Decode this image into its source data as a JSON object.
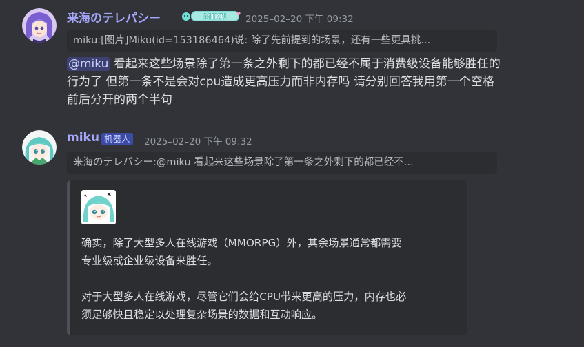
{
  "messages": [
    {
      "username": "来海のテレパシー",
      "username_color": "#a5a8fc",
      "badge_text": "MIKU",
      "timestamp": "2025–02–20 下午 09:32",
      "reply_preview": "miku:[图片]Miku(id=153186464)说: 除了先前提到的场景，还有一些更具挑...",
      "mention": "@miku",
      "content_line1": " 看起来这些场景除了第一条之外剩下的都已经不属于消费级设备能够胜任的",
      "content_line2": "行为了 但第一条不是会对cpu造成更高压力而非内存吗 请分别回答我用第一个空格",
      "content_line3": "前后分开的两个半句"
    },
    {
      "username": "miku",
      "username_color": "#a5a8fc",
      "bot_tag": "机器人",
      "timestamp": "2025–02–20 下午 09:32",
      "reply_preview": "来海のテレパシー:@miku 看起来这些场景除了第一条之外剩下的都已经不...",
      "embed": {
        "para1_line1": "确实，除了大型多人在线游戏（MMORPG）外，其余场景通常都需要",
        "para1_line2": "专业级或企业级设备来胜任。",
        "para2_line1": "对于大型多人在线游戏，尽管它们会给CPU带来更高的压力，内存也必",
        "para2_line2": "须足够快且稳定以处理复杂场景的数据和互动响应。"
      }
    }
  ],
  "colors": {
    "background": "#313338",
    "reply_background": "#2b2d31",
    "mention_text": "#c9cdfb",
    "bot_tag_background": "#3b4ba6",
    "timestamp": "#949ba4"
  },
  "icons": {
    "user_avatar": "anime-avatar-purple-hair-icon",
    "bot_avatar": "miku-avatar-icon",
    "embed_thumbnail": "miku-thumbnail-icon"
  }
}
